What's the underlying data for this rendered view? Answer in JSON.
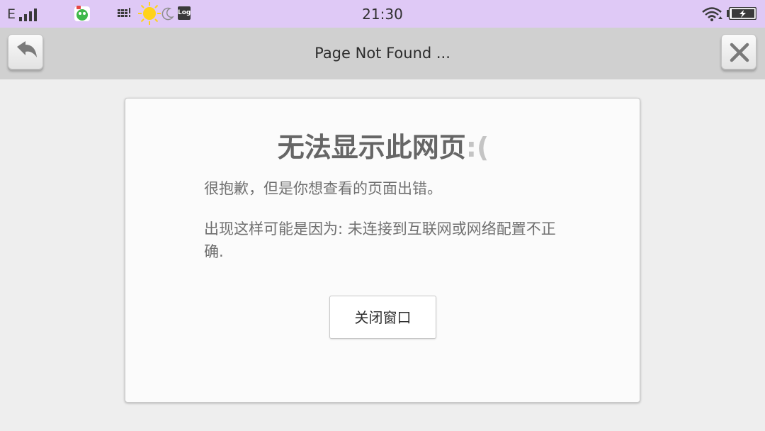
{
  "status_bar": {
    "carrier": "E",
    "time": "21:30",
    "log_badge": "Log",
    "icons": [
      "signal-icon",
      "app-notification-icon",
      "keyboard-icon",
      "weather-sun-icon",
      "moon-icon",
      "log-icon",
      "wifi-icon",
      "battery-charging-icon"
    ]
  },
  "toolbar": {
    "title": "Page Not Found ...",
    "back_icon": "back-arrow-icon",
    "close_icon": "close-icon"
  },
  "dialog": {
    "title": "无法显示此网页",
    "title_emoticon": ":(",
    "message_1": "很抱歉，但是你想查看的页面出错。",
    "message_2": "出现这样可能是因为: 未连接到互联网或网络配置不正确.",
    "close_button_label": "关闭窗口"
  },
  "colors": {
    "status_bar_bg": "#dfc9f6",
    "toolbar_bg": "#d0d0d0",
    "page_bg": "#eeeeee",
    "card_bg": "#fbfbfb",
    "sun": "#ffd21a"
  }
}
